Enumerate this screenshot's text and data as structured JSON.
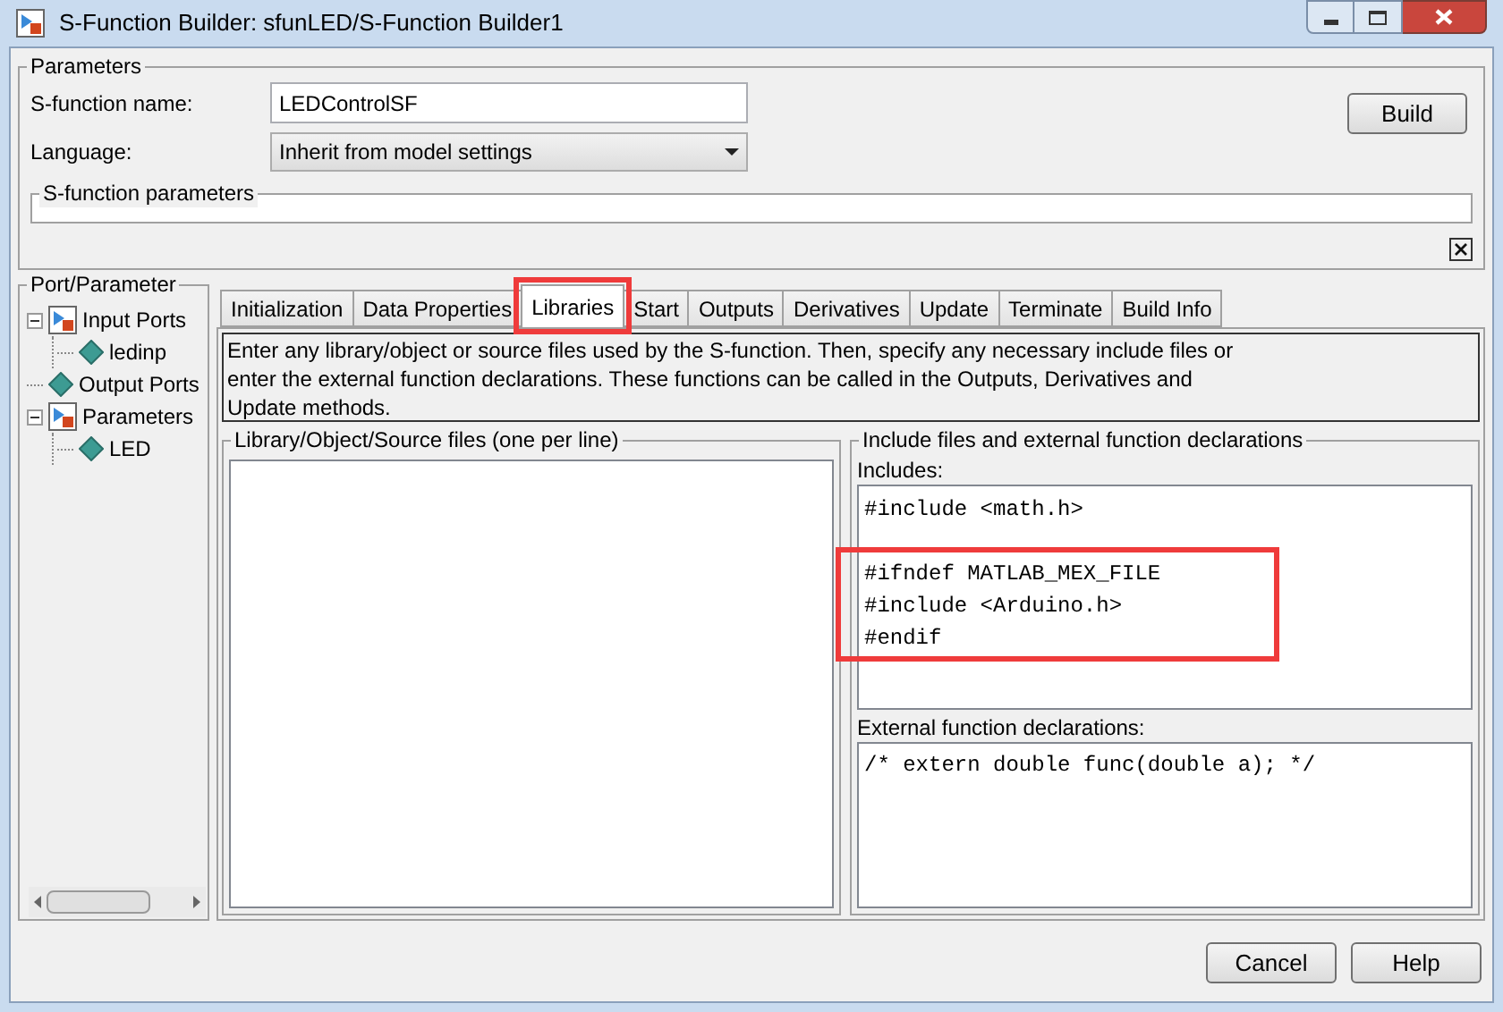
{
  "window": {
    "title": "S-Function Builder: sfunLED/S-Function Builder1"
  },
  "parameters": {
    "title": "Parameters",
    "name_label": "S-function name:",
    "name_value": "LEDControlSF",
    "language_label": "Language:",
    "language_value": "Inherit from model settings",
    "build_button": "Build",
    "sfunction_parameters_title": "S-function parameters"
  },
  "port_parameter": {
    "title": "Port/Parameter",
    "tree": [
      {
        "label": "Input Ports",
        "kind": "group",
        "expanded": true,
        "children": [
          {
            "label": "ledinp",
            "kind": "port"
          }
        ]
      },
      {
        "label": "Output Ports",
        "kind": "port"
      },
      {
        "label": "Parameters",
        "kind": "group",
        "expanded": true,
        "children": [
          {
            "label": "LED",
            "kind": "port"
          }
        ]
      }
    ]
  },
  "tabs": [
    {
      "label": "Initialization",
      "selected": false,
      "highlighted": false
    },
    {
      "label": "Data Properties",
      "selected": false,
      "highlighted": false
    },
    {
      "label": "Libraries",
      "selected": true,
      "highlighted": true
    },
    {
      "label": "Start",
      "selected": false,
      "highlighted": false
    },
    {
      "label": "Outputs",
      "selected": false,
      "highlighted": false
    },
    {
      "label": "Derivatives",
      "selected": false,
      "highlighted": false
    },
    {
      "label": "Update",
      "selected": false,
      "highlighted": false
    },
    {
      "label": "Terminate",
      "selected": false,
      "highlighted": false
    },
    {
      "label": "Build Info",
      "selected": false,
      "highlighted": false
    }
  ],
  "description": "Enter any library/object or source files used by the S-function. Then, specify any necessary include files or enter the external function declarations. These functions can be called in the Outputs, Derivatives and Update methods.",
  "library_files": {
    "title": "Library/Object/Source files (one per line)"
  },
  "include_group": {
    "title": "Include files and external function declarations",
    "includes_label": "Includes:",
    "include_blocks": [
      {
        "lines": [
          "#include <math.h>"
        ],
        "highlighted": false
      },
      {
        "lines": [
          "#ifndef MATLAB_MEX_FILE",
          "#include <Arduino.h>",
          "#endif"
        ],
        "highlighted": true
      }
    ],
    "external_label": "External function declarations:",
    "external_text": "/* extern double func(double a); */"
  },
  "buttons": [
    "Cancel",
    "Help"
  ]
}
